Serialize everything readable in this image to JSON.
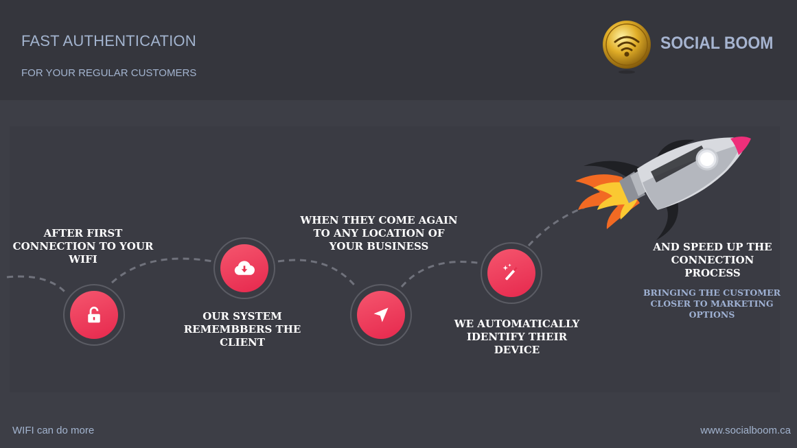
{
  "header": {
    "title": "FAST AUTHENTICATION",
    "subtitle": "FOR YOUR REGULAR CUSTOMERS",
    "brand": "SOCIAL BOOM"
  },
  "steps": [
    {
      "icon": "unlock-icon",
      "text": [
        "AFTER FIRST",
        "CONNECTION TO YOUR",
        "WIFI"
      ]
    },
    {
      "icon": "cloud-download-icon",
      "text": [
        "OUR SYSTEM",
        "REMEMBBERS THE",
        "CLIENT"
      ]
    },
    {
      "icon": "navigation-arrow-icon",
      "text": [
        "WHEN THEY COME AGAIN",
        "TO ANY LOCATION OF",
        "YOUR BUSINESS"
      ]
    },
    {
      "icon": "magic-wand-icon",
      "text": [
        "WE AUTOMATICALLY",
        "IDENTIFY THEIR",
        "DEVICE"
      ]
    }
  ],
  "final": {
    "text": [
      "AND SPEED UP THE",
      "CONNECTION",
      "PROCESS"
    ],
    "subtext": [
      "BRINGING THE CUSTOMER",
      "CLOSER TO MARKETING",
      "OPTIONS"
    ]
  },
  "footer": {
    "left": "WIFI can do more",
    "right": "www.socialboom.ca"
  },
  "colors": {
    "accent": "#e8304f",
    "background": "#3d3e46",
    "header_bg": "#35363d",
    "text_muted": "#a3b4cf"
  }
}
